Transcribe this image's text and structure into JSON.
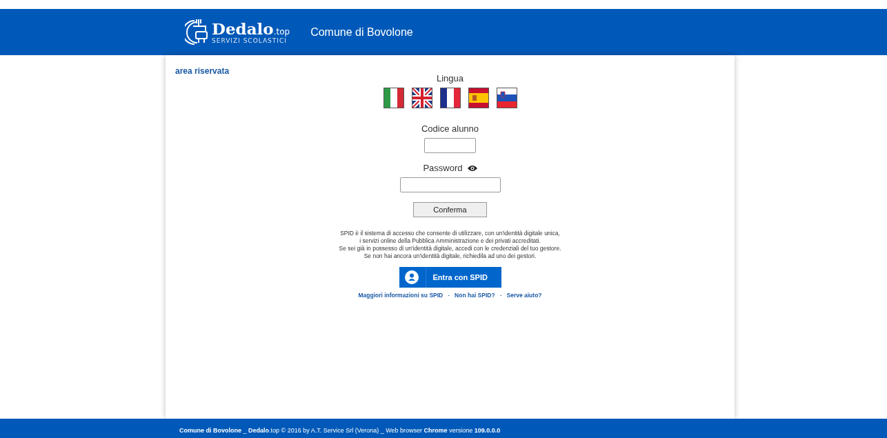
{
  "header": {
    "logo_name": "Dedalo",
    "logo_suffix": ".top",
    "logo_tagline": "SERVIZI SCOLASTICI",
    "title": "Comune di Bovolone"
  },
  "area_title": "area riservata",
  "language": {
    "label": "Lingua",
    "flags": [
      {
        "kind": "it"
      },
      {
        "kind": "gb"
      },
      {
        "kind": "fr"
      },
      {
        "kind": "es"
      },
      {
        "kind": "si"
      }
    ]
  },
  "form": {
    "code_label": "Codice alunno",
    "password_label": "Password",
    "submit": "Conferma"
  },
  "spid": {
    "text": "SPID è il sistema di accesso che consente di utilizzare, con un'identità digitale unica,\ni servizi online della Pubblica Amministrazione e dei privati accreditati.\nSe sei già in possesso di un'identità digitale, accedi con le credenziali del tuo gestore.\nSe non hai ancora un'identità digitale, richiedila ad uno dei gestori.",
    "button": "Entra con SPID",
    "links": [
      "Maggiori informazioni su SPID",
      "Non hai SPID?",
      "Serve aiuto?"
    ],
    "separator": "-"
  },
  "footer": "**Comune di Bovolone** _ **Dedalo**.top © 2016 by A.T. Service Srl (Verona) _ Web browser **Chrome** versione **109.0.0.0**"
}
